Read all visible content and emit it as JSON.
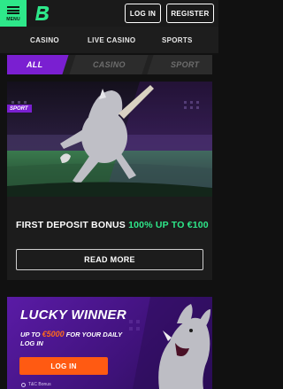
{
  "header": {
    "menu_label": "MENU",
    "login_label": "LOG IN",
    "register_label": "REGISTER"
  },
  "nav": {
    "items": [
      "CASINO",
      "LIVE CASINO",
      "SPORTS"
    ]
  },
  "filters": {
    "items": [
      "ALL",
      "CASINO",
      "SPORT"
    ],
    "active": "ALL"
  },
  "promo1": {
    "badge": "SPORT",
    "title_main": "FIRST DEPOSIT BONUS ",
    "title_highlight": "100% UP TO €100",
    "button_label": "READ MORE"
  },
  "promo2": {
    "title": "LUCKY WINNER",
    "sub_before": "UP TO ",
    "amount": "€5000",
    "sub_after": " FOR YOUR DAILY LOG IN",
    "button_label": "LOG IN",
    "tc_label": "T&C Bonus"
  },
  "colors": {
    "accent_green": "#2ee88a",
    "accent_purple": "#7a1fd1",
    "accent_orange": "#ff5a12",
    "background": "#111111"
  }
}
